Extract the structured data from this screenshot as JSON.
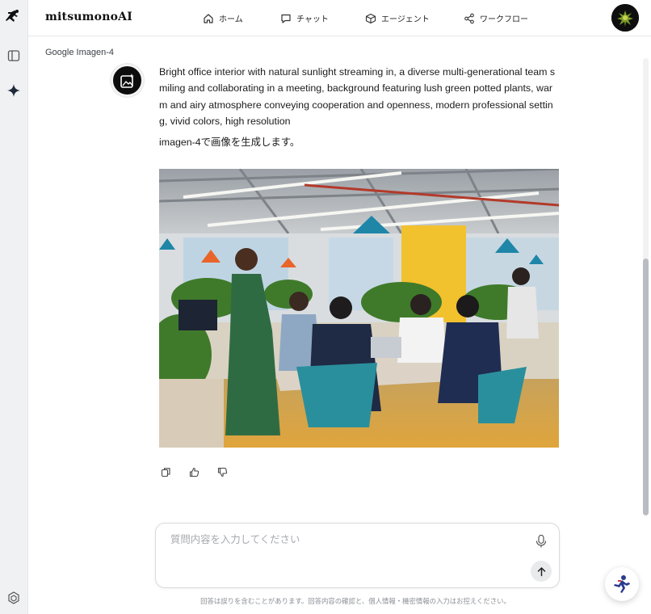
{
  "app": {
    "brand": "mitsumonoAI"
  },
  "nav": {
    "items": [
      {
        "label": "ホーム",
        "icon": "home-icon"
      },
      {
        "label": "チャット",
        "icon": "chat-icon"
      },
      {
        "label": "エージェント",
        "icon": "agent-cube-icon"
      },
      {
        "label": "ワークフロー",
        "icon": "workflow-share-icon"
      }
    ]
  },
  "rail": {
    "icons": [
      "runner-logo-icon",
      "sidebar-toggle-icon",
      "sparkle-icon",
      "settings-hex-icon"
    ]
  },
  "message": {
    "model": "Google Imagen-4",
    "prompt": "Bright office interior with natural sunlight streaming in, a diverse multi-generational team smiling and collaborating in a meeting, background featuring lush green potted plants, warm and airy atmosphere conveying cooperation and openness, modern professional setting, vivid colors, high resolution",
    "status": "imagen-4で画像を生成します。",
    "actions": [
      "copy-icon",
      "thumbs-up-icon",
      "thumbs-down-icon"
    ]
  },
  "composer": {
    "placeholder": "質問内容を入力してください",
    "value": ""
  },
  "footer": {
    "disclaimer": "回答は誤りを含むことがあります。回答内容の確認と、個人情報・機密情報の入力はお控えください。"
  },
  "colors": {
    "rail_bg": "#f0f1f3",
    "accent_dark": "#0d0d0d",
    "fab_runner": "#2a3b8f"
  }
}
